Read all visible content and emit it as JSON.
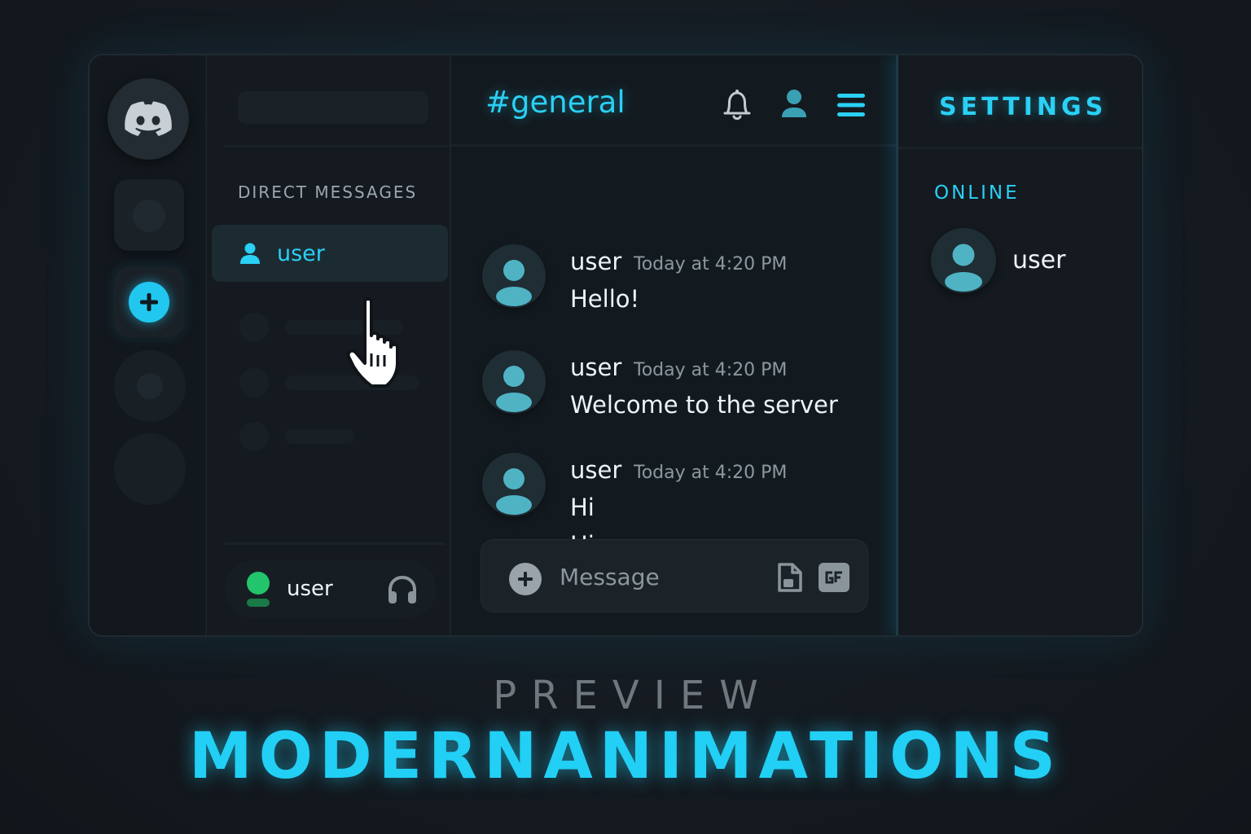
{
  "dm": {
    "title": "DIRECT MESSAGES",
    "active_item": "user",
    "current_user": "user"
  },
  "chat": {
    "channel": "#general",
    "messages": [
      {
        "user": "user",
        "time": "Today at 4:20 PM",
        "lines": [
          "Hello!"
        ]
      },
      {
        "user": "user",
        "time": "Today at 4:20 PM",
        "lines": [
          "Welcome to the server"
        ]
      },
      {
        "user": "user",
        "time": "Today at 4:20 PM",
        "lines": [
          "Hi",
          "Hi"
        ]
      }
    ],
    "composer_placeholder": "Message"
  },
  "members": {
    "title": "SETTINGS",
    "section": "ONLINE",
    "user": "user"
  },
  "footer": {
    "preview": "PREVIEW",
    "brand": "MODERNANIMATIONS"
  },
  "colors": {
    "accent": "#22cff5",
    "online": "#22c56b"
  },
  "icons": [
    "discord-logo-icon",
    "plus-icon",
    "user-icon",
    "bell-icon",
    "menu-icon",
    "headphones-icon",
    "file-icon",
    "gif-icon",
    "hand-cursor-icon"
  ]
}
